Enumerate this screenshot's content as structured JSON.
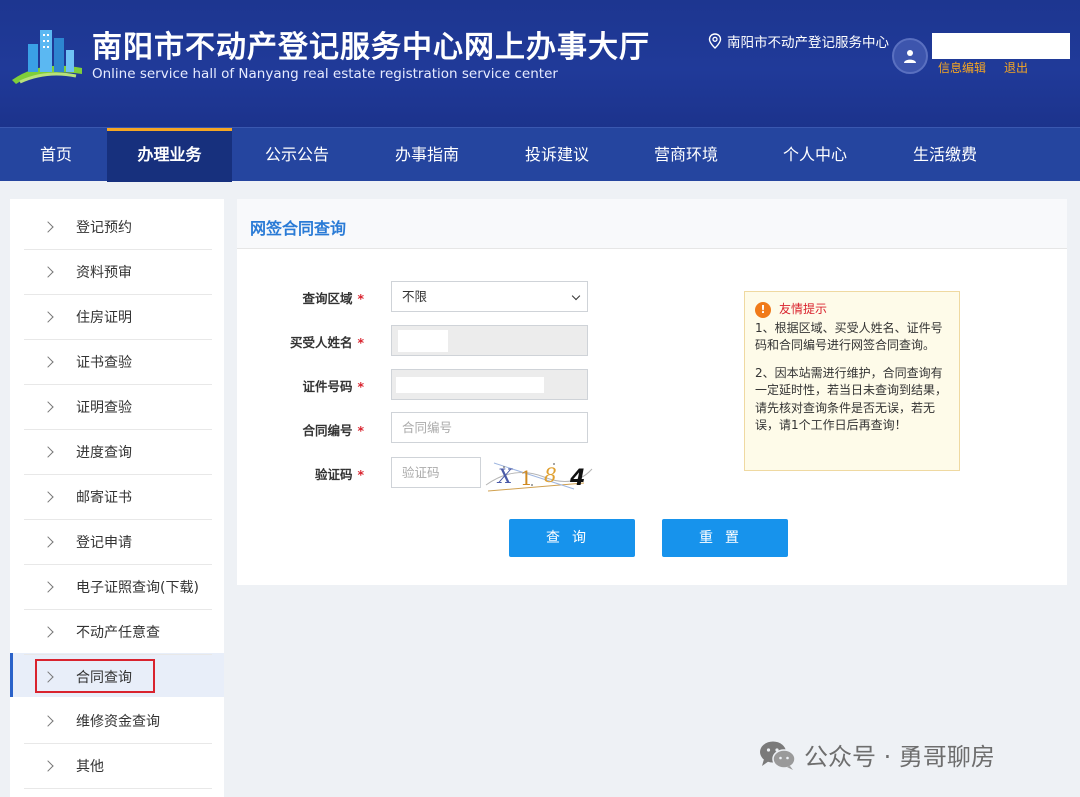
{
  "header": {
    "title": "南阳市不动产登记服务中心网上办事大厅",
    "subtitle": "Online service hall of Nanyang real estate registration service center",
    "location": "南阳市不动产登记服务中心",
    "user_links": [
      "信息编辑",
      "退出"
    ]
  },
  "nav": {
    "items": [
      "首页",
      "办理业务",
      "公示公告",
      "办事指南",
      "投诉建议",
      "营商环境",
      "个人中心",
      "生活缴费"
    ],
    "active": "办理业务"
  },
  "sidebar": {
    "items": [
      "登记预约",
      "资料预审",
      "住房证明",
      "证书查验",
      "证明查验",
      "进度查询",
      "邮寄证书",
      "登记申请",
      "电子证照查询(下载)",
      "不动产任意查",
      "合同查询",
      "维修资金查询",
      "其他"
    ],
    "active": "合同查询"
  },
  "panel": {
    "title": "网签合同查询",
    "fields": {
      "region_label": "查询区域",
      "region_value": "不限",
      "buyer_label": "买受人姓名",
      "cert_label": "证件号码",
      "contract_label": "合同编号",
      "contract_placeholder": "合同编号",
      "captcha_label": "验证码",
      "captcha_placeholder": "验证码",
      "required_mark": "*"
    },
    "captcha_text": [
      "X",
      "1",
      "8",
      "4"
    ],
    "buttons": {
      "query": "查询",
      "reset": "重置"
    }
  },
  "tip": {
    "title": "友情提示",
    "icon": "!",
    "p1": "1、根据区域、买受人姓名、证件号码和合同编号进行网签合同查询。",
    "p2": "2、因本站需进行维护，合同查询有一定延时性，若当日未查询到结果，请先核对查询条件是否无误，若无误，请1个工作日后再查询！"
  },
  "watermark": {
    "text": "公众号 · 勇哥聊房"
  },
  "colors": {
    "header": "#1d3690",
    "nav": "#25459f",
    "accent": "#1793ec",
    "highlight": "#d9232e",
    "orange": "#f5a623"
  }
}
